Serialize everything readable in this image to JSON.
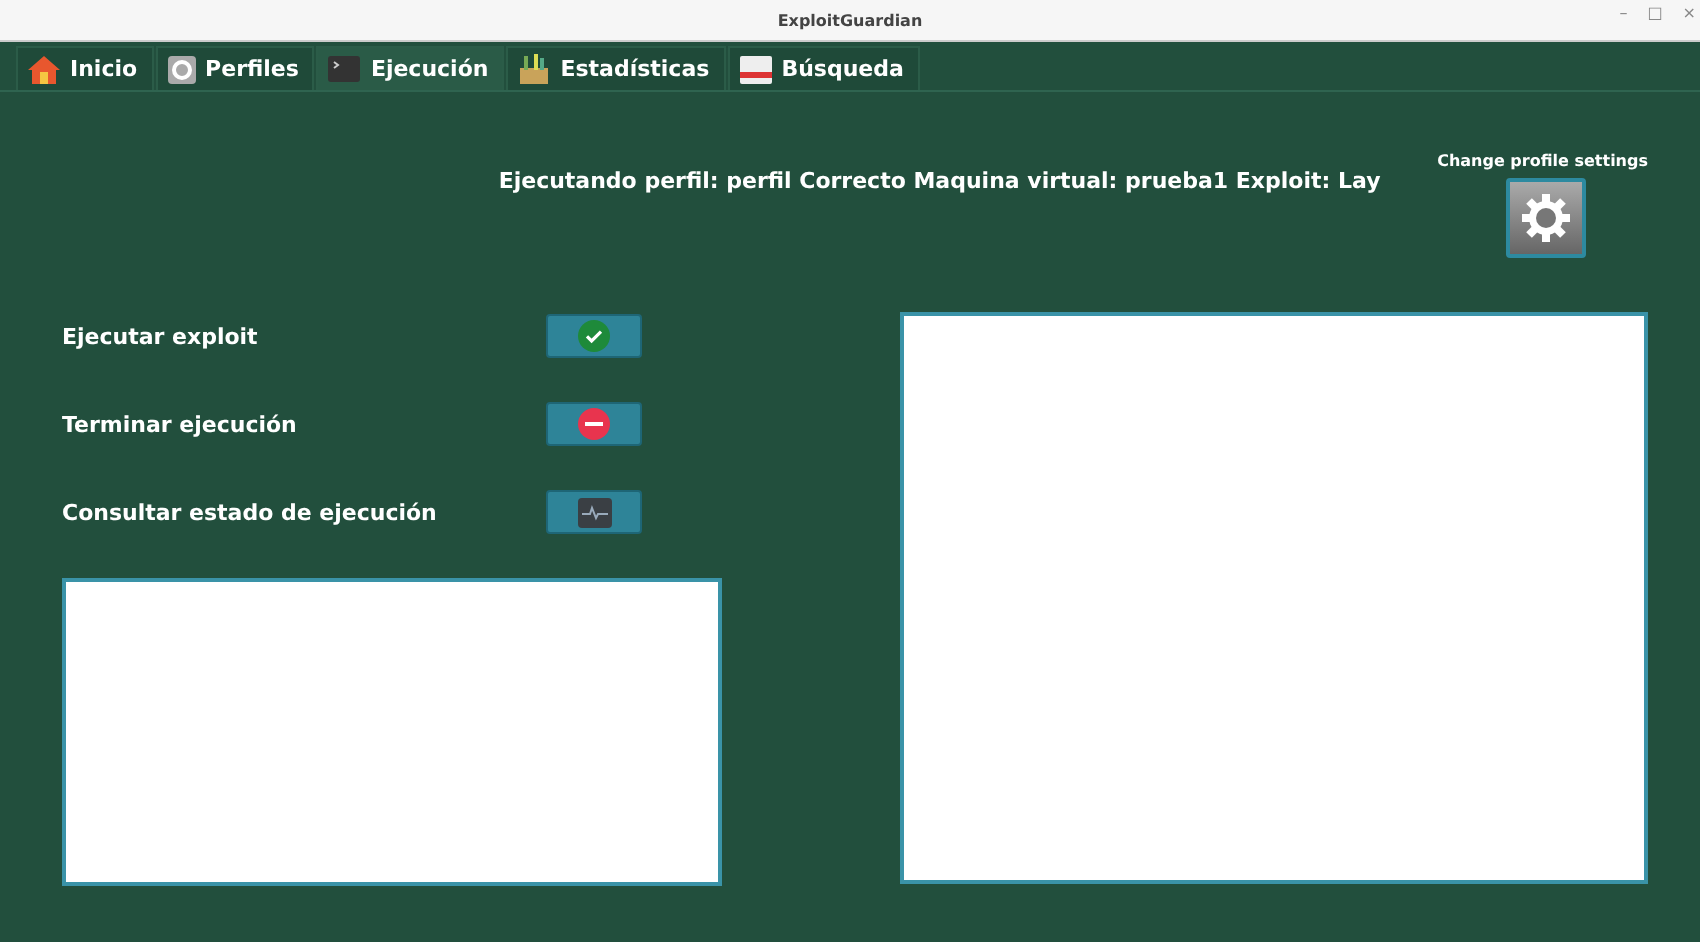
{
  "window": {
    "title": "ExploitGuardian",
    "controls": [
      "–",
      "□",
      "×"
    ]
  },
  "tabs": [
    {
      "label": "Inicio",
      "selected": false
    },
    {
      "label": "Perfiles",
      "selected": false
    },
    {
      "label": "Ejecución",
      "selected": true
    },
    {
      "label": "Estadísticas",
      "selected": false
    },
    {
      "label": "Búsqueda",
      "selected": false
    }
  ],
  "header": "Ejecutando perfil: perfil Correcto Maquina virtual: prueba1 Exploit: Lay",
  "settings": {
    "label": "Change profile settings"
  },
  "actions": [
    {
      "label": "Ejecutar exploit"
    },
    {
      "label": "Terminar ejecución"
    },
    {
      "label": "Consultar estado de ejecución"
    }
  ]
}
